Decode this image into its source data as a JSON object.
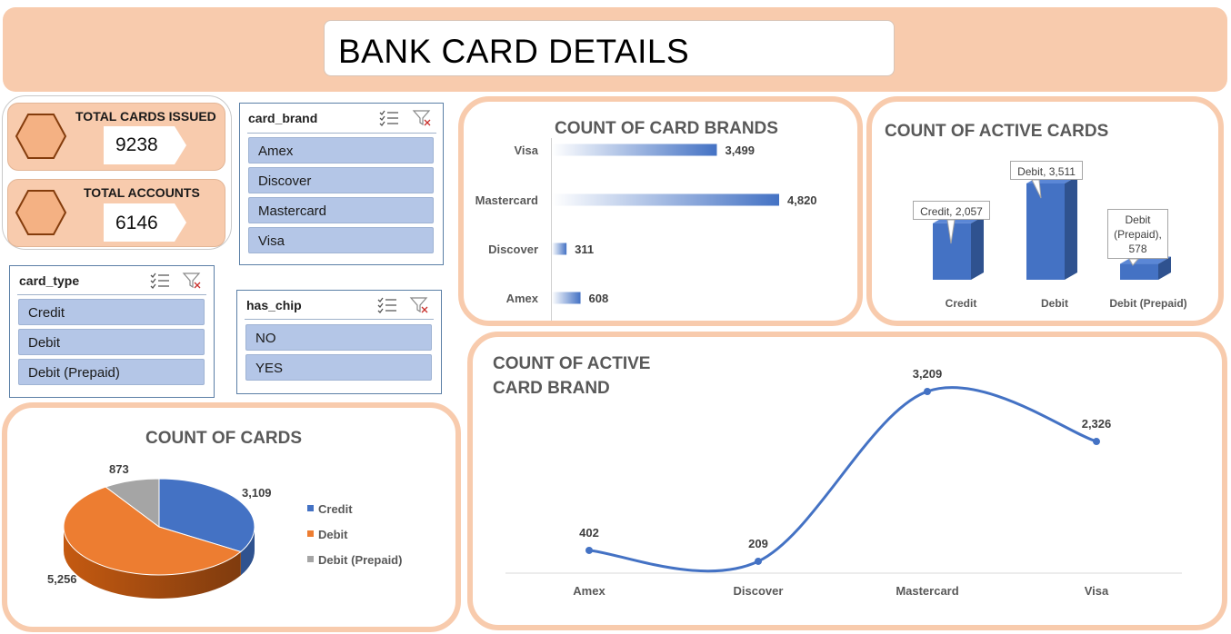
{
  "header": {
    "title": "BANK CARD DETAILS"
  },
  "kpis": [
    {
      "label": "TOTAL CARDS ISSUED",
      "value": "9238"
    },
    {
      "label": "TOTAL ACCOUNTS",
      "value": "6146"
    }
  ],
  "slicers": {
    "card_brand": {
      "title": "card_brand",
      "items": [
        "Amex",
        "Discover",
        "Mastercard",
        "Visa"
      ]
    },
    "card_type": {
      "title": "card_type",
      "items": [
        "Credit",
        "Debit",
        "Debit (Prepaid)"
      ]
    },
    "has_chip": {
      "title": "has_chip",
      "items": [
        "NO",
        "YES"
      ]
    }
  },
  "colors": {
    "banner": "#f8cbad",
    "blue": "#4472c4",
    "orange": "#ed7d31",
    "gray": "#a5a5a5",
    "slicer_item": "#b4c6e7"
  },
  "icons": [
    "hexagon-icon",
    "multi-select-icon",
    "clear-filter-icon"
  ],
  "chart_data": [
    {
      "id": "brands",
      "type": "bar",
      "title": "COUNT OF CARD BRANDS",
      "orientation": "horizontal",
      "categories": [
        "Visa",
        "Mastercard",
        "Discover",
        "Amex"
      ],
      "values": [
        3499,
        4820,
        311,
        608
      ],
      "data_labels": [
        "3,499",
        "4,820",
        "311",
        "608"
      ]
    },
    {
      "id": "active_cards",
      "type": "bar",
      "title": "COUNT OF ACTIVE CARDS",
      "categories": [
        "Credit",
        "Debit",
        "Debit (Prepaid)"
      ],
      "values": [
        2057,
        3511,
        578
      ],
      "callouts": [
        "Credit, 2,057",
        "Debit, 3,511",
        "Debit (Prepaid), 578"
      ]
    },
    {
      "id": "cards_pie",
      "type": "pie",
      "title": "COUNT OF CARDS",
      "categories": [
        "Credit",
        "Debit",
        "Debit (Prepaid)"
      ],
      "values": [
        3109,
        5256,
        873
      ],
      "data_labels": [
        "3,109",
        "5,256",
        "873"
      ],
      "legend": "right"
    },
    {
      "id": "active_brand_line",
      "type": "line",
      "title": "COUNT OF ACTIVE CARD BRAND",
      "title_lines": [
        "COUNT OF ACTIVE",
        "CARD BRAND"
      ],
      "categories": [
        "Amex",
        "Discover",
        "Mastercard",
        "Visa"
      ],
      "values": [
        402,
        209,
        3209,
        2326
      ],
      "data_labels": [
        "402",
        "209",
        "3,209",
        "2,326"
      ]
    }
  ]
}
